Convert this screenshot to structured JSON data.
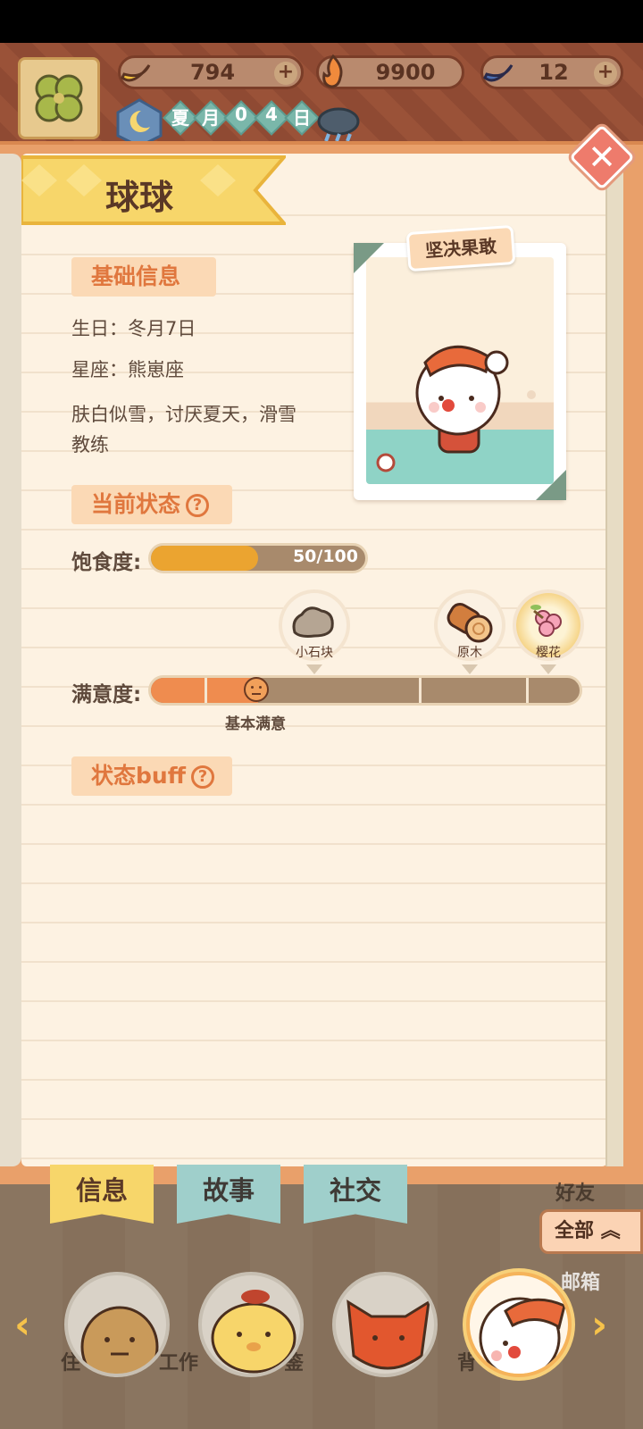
{
  "resources": [
    {
      "name": "banana",
      "value": "794",
      "color": "#f2c13d"
    },
    {
      "name": "flame",
      "value": "9900",
      "color": "#f08a3c"
    },
    {
      "name": "blue-banana",
      "value": "12",
      "color": "#4d6fb0"
    }
  ],
  "date": {
    "chars": [
      "夏",
      "月",
      "0",
      "4",
      "日"
    ]
  },
  "character": {
    "name": "球球",
    "trait": "坚决果敢"
  },
  "basic_info": {
    "title": "基础信息",
    "birthday": "生日：冬月7日",
    "constellation": "星座：熊崽座",
    "description_line1": "肤白似雪，讨厌夏天，滑雪",
    "description_line2": "教练"
  },
  "current_status": {
    "title": "当前状态",
    "satiety_label": "饱食度:",
    "satiety_value": 50,
    "satiety_max": 100,
    "satiety_text": "50/100",
    "satisfaction_label": "满意度:",
    "satisfaction_level": 0.25,
    "satisfaction_caption": "基本满意",
    "rewards": [
      {
        "label": "小石块"
      },
      {
        "label": "原木"
      },
      {
        "label": "樱花"
      }
    ]
  },
  "buff": {
    "title": "状态buff"
  },
  "tabs": [
    {
      "label": "信息",
      "active": true
    },
    {
      "label": "故事",
      "active": false
    },
    {
      "label": "社交",
      "active": false
    }
  ],
  "filter": {
    "label": "全部"
  },
  "ghost_labels": {
    "friends": "好友",
    "mail": "邮箱",
    "live": "住",
    "work": "工作",
    "guide": "鉴",
    "bag": "背"
  },
  "colors": {
    "accent": "#e0773e",
    "panel": "#fdf2e2",
    "banner": "#f7d66a"
  }
}
